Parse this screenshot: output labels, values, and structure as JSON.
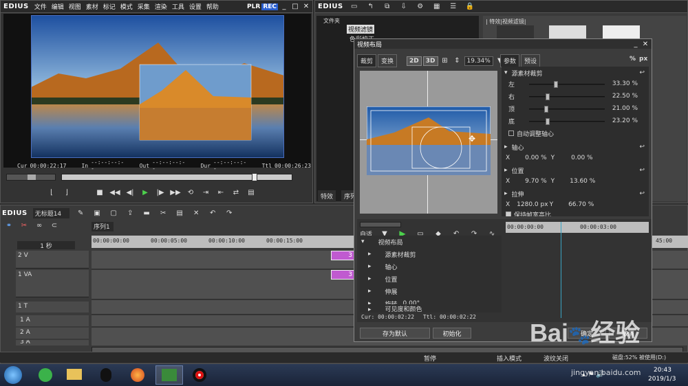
{
  "player": {
    "logo": "EDIUS",
    "menu": [
      "文件",
      "编辑",
      "视图",
      "素材",
      "标记",
      "模式",
      "采集",
      "渲染",
      "工具",
      "设置",
      "帮助"
    ],
    "plr": "PLR",
    "rec": "REC",
    "cur_label": "Cur",
    "cur_value": "00:00:22:17",
    "in_label": "In",
    "in_value": "--:--:--:--",
    "out_label": "Out",
    "out_value": "--:--:--:--",
    "dur_label": "Dur",
    "dur_value": "--:--:--:--",
    "ttl_label": "Ttl",
    "ttl_value": "00:00:26:23"
  },
  "bin": {
    "logo": "EDIUS",
    "folder_header": "文件夹",
    "tree_item": "视频滤镜",
    "tree_sub": "色彩校正",
    "tab_effects": "特效",
    "tab_seq": "序列",
    "thumb_header": "| 特效|视频滤镜|"
  },
  "layout_dialog": {
    "title": "视频布局",
    "tab_crop": "裁剪",
    "tab_transform": "变换",
    "mode_2d": "2D",
    "mode_3d": "3D",
    "zoom": "19.34%",
    "tab_params": "参数",
    "tab_presets": "预设",
    "unit_percent": "%",
    "unit_px": "px",
    "source_crop": "源素材裁剪",
    "crop_left_label": "左",
    "crop_left": "33.30 %",
    "crop_right_label": "右",
    "crop_right": "22.50 %",
    "crop_top_label": "顶",
    "crop_top": "21.00 %",
    "crop_bottom_label": "底",
    "crop_bottom": "23.20 %",
    "auto_pivot": "自动调整轴心",
    "pivot": "轴心",
    "pivot_x": "X",
    "pivot_x_val": "0.00 %",
    "pivot_y": "Y",
    "pivot_y_val": "0.00 %",
    "position": "位置",
    "pos_x": "X",
    "pos_x_val": "9.70 %",
    "pos_y": "Y",
    "pos_y_val": "13.60 %",
    "stretch": "拉伸",
    "str_x": "X",
    "str_x_val": "1280.0 px",
    "str_y": "Y",
    "str_y_val": "66.70 %",
    "keep_ratio": "保持帧宽高比",
    "auto_label": "自适",
    "kf_root": "视频布局",
    "kf_items": [
      "源素材裁剪",
      "轴心",
      "位置",
      "伸展",
      "旋转",
      "可见度和颜色"
    ],
    "rotate_val": "0.00°",
    "cur_line": "Cur: 00:00:02:22",
    "ttl_line": "Ttl: 00:00:02:22",
    "ruler": [
      "00:00:00:00",
      "00:00:03:00"
    ],
    "save_default": "存为默认",
    "initialize": "初始化",
    "ok": "确定",
    "cancel": "取消"
  },
  "timeline": {
    "logo": "EDIUS",
    "project": "无标题14",
    "sequence_tab": "序列1",
    "scale": "1 秒",
    "ruler": [
      "00:00:00:00",
      "00:00:05:00",
      "00:00:10:00",
      "00:00:15:00"
    ],
    "ruler_right": "45:00",
    "tracks": [
      "2 V",
      "1 VA",
      "1 T",
      "1 A",
      "2 A",
      "3 A"
    ],
    "clip_label": "3"
  },
  "statusbar": {
    "pause": "暂停",
    "insert_mode": "插入模式",
    "ripple_off": "波纹关闭",
    "disk": "磁盘:52% 被使用(D:)"
  },
  "taskbar": {
    "time": "20:43",
    "date": "2019/1/3"
  },
  "watermark": {
    "site": "jingyan.baidu.com"
  }
}
